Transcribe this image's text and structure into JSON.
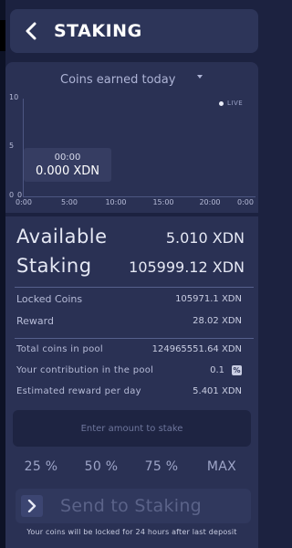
{
  "header": {
    "title": "STAKING"
  },
  "chart": {
    "title": "Coins earned today",
    "live_label": "LIVE",
    "tooltip": {
      "time": "00:00",
      "value": "0.000 XDN"
    }
  },
  "chart_data": {
    "type": "line",
    "title": "Coins earned today",
    "xlabel": "",
    "ylabel": "",
    "x_ticks": [
      "0:00",
      "5:00",
      "10:00",
      "15:00",
      "20:00",
      "0:00"
    ],
    "y_ticks": [
      "10",
      "5",
      "0",
      "0"
    ],
    "ylim": [
      0,
      10
    ],
    "series": [
      {
        "values": [
          {
            "x": "00:00",
            "y": 0.0
          }
        ]
      }
    ],
    "grid": false,
    "legend": "none"
  },
  "balances": {
    "available_label": "Available",
    "available_value": "5.010 XDN",
    "staking_label": "Staking",
    "staking_value": "105999.12 XDN"
  },
  "details": {
    "locked_label": "Locked Coins",
    "locked_value": "105971.1 XDN",
    "reward_label": "Reward",
    "reward_value": "28.02 XDN"
  },
  "pool": {
    "total_label": "Total coins in pool",
    "total_value": "124965551.64 XDN",
    "contribution_label": "Your contribution in the pool",
    "contribution_value": "0.1",
    "contribution_unit": "%",
    "estimated_label": "Estimated reward per day",
    "estimated_value": "5.401 XDN"
  },
  "stake": {
    "placeholder": "Enter amount to stake",
    "percent_options": [
      "25 %",
      "50 %",
      "75 %",
      "MAX"
    ],
    "send_label": "Send to Staking",
    "footnote": "Your coins will be locked for 24 hours after last deposit"
  },
  "icons": {
    "back": "chevron-left-icon",
    "dropdown": "caret-down-icon",
    "live": "live-dot-icon",
    "send": "chevron-right-icon"
  },
  "colors": {
    "background": "#1c2240",
    "card": "#2a3154",
    "header": "#2d3559",
    "text": "#c9cde2"
  }
}
